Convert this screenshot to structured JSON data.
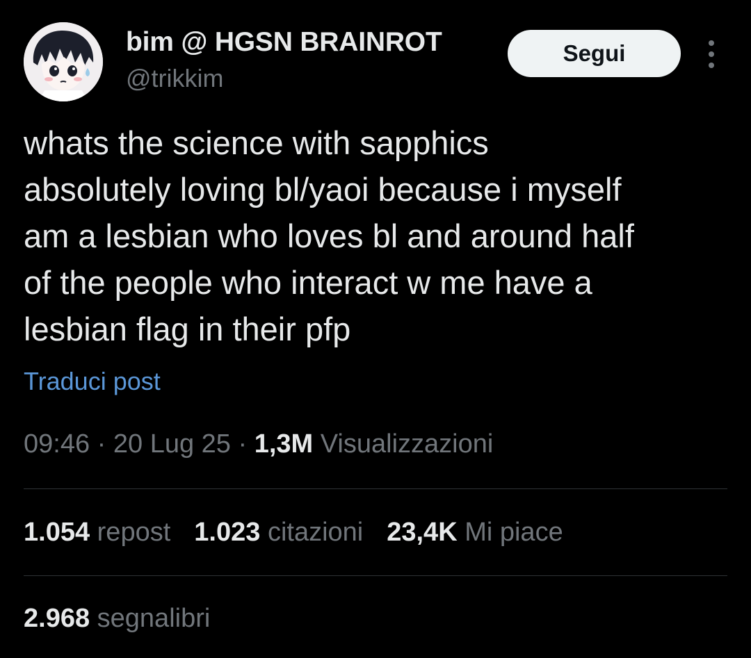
{
  "author": {
    "display_name": "bim @ HGSN BRAINROT",
    "handle": "@trikkim",
    "follow_label": "Segui",
    "more_icon": "more-vertical-icon"
  },
  "post": {
    "text": "whats the science with sapphics\nabsolutely loving bl/yaoi because i myself\nam a lesbian who loves bl and around half\nof the people who interact w me have a\nlesbian flag in their pfp",
    "translate_label": "Traduci post"
  },
  "meta": {
    "time": "09:46",
    "date": "20 Lug 25",
    "separator": "·",
    "views_count": "1,3M",
    "views_label": "Visualizzazioni"
  },
  "stats": {
    "reposts_count": "1.054",
    "reposts_label": "repost",
    "quotes_count": "1.023",
    "quotes_label": "citazioni",
    "likes_count": "23,4K",
    "likes_label": "Mi piace",
    "bookmarks_count": "2.968",
    "bookmarks_label": "segnalibri"
  },
  "colors": {
    "background": "#000000",
    "text_primary": "#e7e9ea",
    "text_secondary": "#71767b",
    "link": "#5b97d8",
    "button_bg": "#eff3f4",
    "divider": "#2f3336"
  }
}
